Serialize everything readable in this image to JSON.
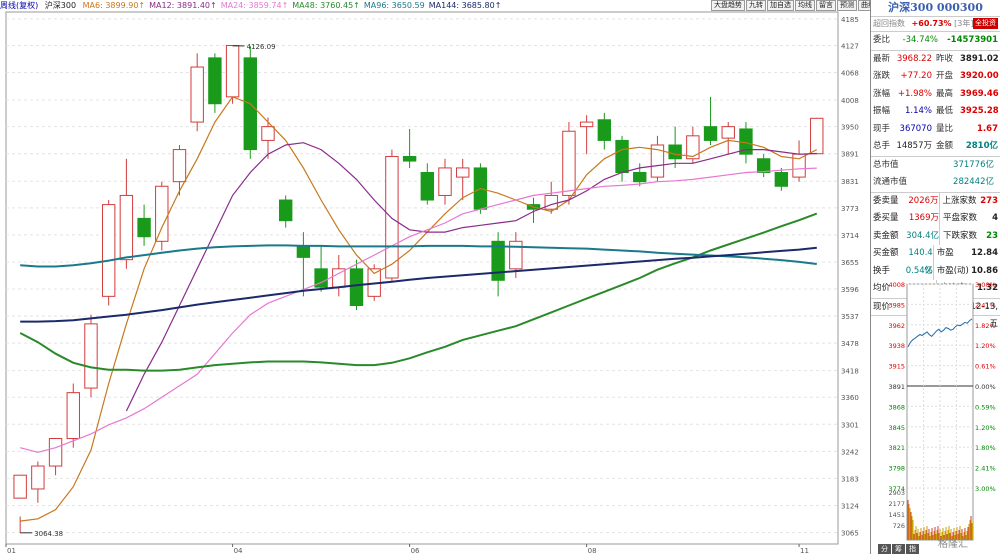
{
  "header": {
    "period": "周线(复权)",
    "name": "沪深300",
    "ma_items": [
      {
        "label": "MA6: 3899.90↑",
        "color": "#c8781e"
      },
      {
        "label": "MA12: 3891.40↑",
        "color": "#8a2b8a"
      },
      {
        "label": "MA24: 3859.74↑",
        "color": "#e678d2"
      },
      {
        "label": "MA48: 3760.45↑",
        "color": "#2a8a2a"
      },
      {
        "label": "MA96: 3650.59",
        "color": "#1a7a8a"
      },
      {
        "label": "MA144: 3685.80↑",
        "color": "#1a2a6a"
      }
    ],
    "toolbar": [
      "大盘趋势",
      "九转",
      "加自选",
      "均线",
      "留言",
      "预测",
      "曲线"
    ]
  },
  "chart_data": {
    "type": "candlestick",
    "y_ticks": [
      4185,
      4127,
      4068,
      4008,
      3950,
      3891,
      3831,
      3773,
      3714,
      3655,
      3596,
      3537,
      3478,
      3418,
      3360,
      3301,
      3242,
      3183,
      3124,
      3065
    ],
    "y_range": [
      3040,
      4200
    ],
    "x_ticks": [
      "01",
      "04",
      "06",
      "08",
      "11"
    ],
    "annotations": [
      {
        "label": "4126.09",
        "value": 4126.09
      },
      {
        "label": "3064.38",
        "value": 3064.38
      }
    ],
    "candles": [
      [
        3140,
        3190,
        3100,
        3064.38
      ],
      [
        3160,
        3210,
        3130,
        3220
      ],
      [
        3210,
        3270,
        3190,
        3270
      ],
      [
        3270,
        3370,
        3250,
        3390
      ],
      [
        3380,
        3520,
        3360,
        3540
      ],
      [
        3580,
        3780,
        3560,
        3790
      ],
      [
        3660,
        3800,
        3640,
        3880
      ],
      [
        3750,
        3710,
        3690,
        3780
      ],
      [
        3700,
        3820,
        3680,
        3830
      ],
      [
        3830,
        3900,
        3800,
        3910
      ],
      [
        3960,
        4080,
        3940,
        4110
      ],
      [
        4100,
        4000,
        3980,
        4110
      ],
      [
        4015,
        4127,
        4000,
        4126.09
      ],
      [
        4100,
        3900,
        3880,
        4126
      ],
      [
        3920,
        3950,
        3880,
        3970
      ],
      [
        3790,
        3745,
        3730,
        3800
      ],
      [
        3690,
        3665,
        3580,
        3720
      ],
      [
        3640,
        3600,
        3590,
        3690
      ],
      [
        3600,
        3640,
        3580,
        3670
      ],
      [
        3640,
        3560,
        3550,
        3660
      ],
      [
        3580,
        3640,
        3570,
        3650
      ],
      [
        3620,
        3885,
        3610,
        3900
      ],
      [
        3885,
        3875,
        3860,
        3945
      ],
      [
        3850,
        3790,
        3780,
        3870
      ],
      [
        3800,
        3860,
        3780,
        3880
      ],
      [
        3840,
        3860,
        3790,
        3880
      ],
      [
        3860,
        3770,
        3760,
        3870
      ],
      [
        3700,
        3615,
        3580,
        3720
      ],
      [
        3640,
        3700,
        3620,
        3720
      ],
      [
        3780,
        3770,
        3740,
        3795
      ],
      [
        3770,
        3800,
        3760,
        3830
      ],
      [
        3800,
        3940,
        3780,
        3960
      ],
      [
        3950,
        3960,
        3890,
        3975
      ],
      [
        3965,
        3920,
        3900,
        3980
      ],
      [
        3920,
        3850,
        3830,
        3930
      ],
      [
        3850,
        3830,
        3820,
        3870
      ],
      [
        3840,
        3910,
        3830,
        3930
      ],
      [
        3910,
        3880,
        3860,
        3950
      ],
      [
        3880,
        3930,
        3870,
        3950
      ],
      [
        3950,
        3920,
        3910,
        4015
      ],
      [
        3925,
        3950,
        3890,
        3960
      ],
      [
        3945,
        3890,
        3870,
        3960
      ],
      [
        3880,
        3850,
        3840,
        3890
      ],
      [
        3850,
        3820,
        3810,
        3860
      ],
      [
        3840,
        3890,
        3830,
        3920
      ],
      [
        3891.02,
        3968.22,
        3890,
        3969.46
      ]
    ],
    "ma_lines": [
      {
        "name": "MA6",
        "color": "#c8781e",
        "values": [
          3090,
          3095,
          3115,
          3165,
          3245,
          3390,
          3520,
          3640,
          3730,
          3810,
          3880,
          3960,
          4015,
          4000,
          3960,
          3920,
          3860,
          3790,
          3725,
          3670,
          3630,
          3650,
          3680,
          3720,
          3760,
          3795,
          3815,
          3805,
          3790,
          3775,
          3765,
          3790,
          3845,
          3880,
          3900,
          3905,
          3900,
          3890,
          3885,
          3905,
          3920,
          3915,
          3905,
          3885,
          3880,
          3899.9
        ]
      },
      {
        "name": "MA12",
        "color": "#8a2b8a",
        "values": [
          null,
          null,
          null,
          null,
          null,
          null,
          3330,
          3410,
          3480,
          3560,
          3640,
          3720,
          3800,
          3850,
          3890,
          3910,
          3915,
          3900,
          3870,
          3835,
          3790,
          3750,
          3725,
          3720,
          3720,
          3730,
          3735,
          3740,
          3745,
          3765,
          3780,
          3790,
          3810,
          3835,
          3850,
          3860,
          3865,
          3870,
          3870,
          3880,
          3890,
          3900,
          3900,
          3895,
          3890,
          3891.4
        ]
      },
      {
        "name": "MA24",
        "color": "#e678d2",
        "values": [
          3250,
          3240,
          3250,
          3265,
          3280,
          3300,
          3315,
          3335,
          3360,
          3385,
          3410,
          3455,
          3500,
          3540,
          3565,
          3580,
          3595,
          3610,
          3630,
          3650,
          3670,
          3690,
          3710,
          3725,
          3740,
          3760,
          3770,
          3780,
          3790,
          3800,
          3805,
          3810,
          3815,
          3820,
          3822,
          3825,
          3830,
          3832,
          3835,
          3840,
          3845,
          3850,
          3852,
          3855,
          3858,
          3859.74
        ]
      },
      {
        "name": "MA48",
        "color": "#2a8a2a",
        "values": [
          3500,
          3480,
          3455,
          3435,
          3425,
          3420,
          3420,
          3418,
          3418,
          3420,
          3425,
          3430,
          3433,
          3436,
          3438,
          3438,
          3438,
          3436,
          3433,
          3430,
          3430,
          3435,
          3445,
          3458,
          3470,
          3485,
          3495,
          3505,
          3515,
          3530,
          3545,
          3560,
          3575,
          3590,
          3605,
          3620,
          3638,
          3652,
          3665,
          3680,
          3693,
          3706,
          3719,
          3733,
          3746,
          3760.45
        ]
      },
      {
        "name": "MA96",
        "color": "#1a7a8a",
        "values": [
          3648,
          3645,
          3645,
          3648,
          3652,
          3658,
          3665,
          3670,
          3675,
          3680,
          3684,
          3687,
          3689,
          3690,
          3691,
          3691,
          3690,
          3690,
          3689,
          3689,
          3689,
          3689,
          3689,
          3690,
          3690,
          3690,
          3689,
          3689,
          3688,
          3687,
          3686,
          3685,
          3684,
          3682,
          3680,
          3678,
          3675,
          3673,
          3671,
          3669,
          3667,
          3665,
          3662,
          3659,
          3655,
          3650.59
        ]
      },
      {
        "name": "MA144",
        "color": "#1a2a6a",
        "values": [
          3525,
          3525,
          3526,
          3528,
          3532,
          3536,
          3540,
          3545,
          3550,
          3556,
          3562,
          3567,
          3572,
          3577,
          3582,
          3587,
          3592,
          3596,
          3600,
          3604,
          3608,
          3612,
          3616,
          3620,
          3623,
          3626,
          3629,
          3632,
          3635,
          3638,
          3641,
          3644,
          3647,
          3650,
          3653,
          3656,
          3659,
          3662,
          3664,
          3667,
          3670,
          3673,
          3676,
          3679,
          3682,
          3685.8
        ]
      }
    ]
  },
  "quote": {
    "title": "沪深300 000300",
    "sub_left": "超回指数",
    "sub_ratio": "+60.73%",
    "sub_tag": "[3年]",
    "sub_btn": "全投资",
    "row_a": [
      {
        "l": "委比",
        "v": "-34.74%",
        "c": "green",
        "v2": "-14573901",
        "c2": "green"
      }
    ],
    "rows": [
      {
        "l": "最新",
        "v": "3968.22",
        "c": "red",
        "l2": "昨收",
        "v2": "3891.02",
        "c2": ""
      },
      {
        "l": "涨跌",
        "v": "+77.20",
        "c": "red",
        "l2": "开盘",
        "v2": "3920.00",
        "c2": "red"
      },
      {
        "l": "涨幅",
        "v": "+1.98%",
        "c": "red",
        "l2": "最高",
        "v2": "3969.46",
        "c2": "red"
      },
      {
        "l": "振幅",
        "v": "1.14%",
        "c": "blue",
        "l2": "最低",
        "v2": "3925.28",
        "c2": "red"
      },
      {
        "l": "现手",
        "v": "367070",
        "c": "blue",
        "l2": "量比",
        "v2": "1.67",
        "c2": "red"
      },
      {
        "l": "总手",
        "v": "14857万",
        "c": "",
        "l2": "金额",
        "v2": "2810亿",
        "c2": "teal"
      }
    ],
    "cap_rows": [
      {
        "l": "总市值",
        "v": "371776亿"
      },
      {
        "l": "流通市值",
        "v": "282442亿"
      }
    ],
    "stat_rows": [
      {
        "l": "委卖量",
        "v": "2026万",
        "c": "red",
        "l2": "上涨家数",
        "v2": "273",
        "c2": "red"
      },
      {
        "l": "委买量",
        "v": "1369万",
        "c": "red",
        "l2": "平盘家数",
        "v2": "4",
        "c2": ""
      },
      {
        "l": "卖金额",
        "v": "304.4亿",
        "c": "teal",
        "l2": "下跌家数",
        "v2": "23",
        "c2": "green"
      },
      {
        "l": "买金额",
        "v": "140.4亿",
        "c": "teal",
        "l2": "市盈",
        "v2": "12.84",
        "c2": ""
      },
      {
        "l": "换手",
        "v": "0.54%",
        "c": "teal",
        "l2": "市盈(动)",
        "v2": "10.86",
        "c2": ""
      },
      {
        "l": "均价",
        "v": "-",
        "c": "",
        "l2": "市净率",
        "v2": "1.32",
        "c2": ""
      }
    ],
    "status": {
      "label": "现价",
      "price": "3968.22",
      "date": "2019-12-13,五"
    }
  },
  "mini": {
    "left_ticks": [
      "4008",
      "3985",
      "3962",
      "3938",
      "3915",
      "3891",
      "3868",
      "3845",
      "3821",
      "3798",
      "3774"
    ],
    "right_ticks": [
      "3.00%",
      "2.41%",
      "1.82%",
      "1.20%",
      "0.61%",
      "0.00%",
      "0.59%",
      "1.20%",
      "1.80%",
      "2.41%",
      "3.00%"
    ],
    "vol_ticks": [
      "2903",
      "2177",
      "1451",
      "726"
    ],
    "price_line": [
      3936,
      3941,
      3944,
      3946,
      3948,
      3950,
      3949,
      3951,
      3953,
      3950,
      3948,
      3951,
      3954,
      3956,
      3953,
      3955,
      3958,
      3957,
      3955,
      3956,
      3959,
      3961,
      3960,
      3962,
      3964,
      3963,
      3966,
      3968
    ]
  },
  "tabs": [
    "分",
    "筹",
    "指"
  ],
  "watermark": "格隆汇"
}
